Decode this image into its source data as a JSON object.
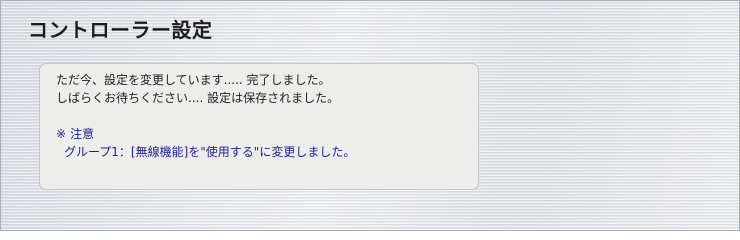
{
  "header": {
    "title": "コントローラー設定"
  },
  "message": {
    "line1": "ただ今、設定を変更しています..... 完了しました。",
    "line2": "しばらくお待ちください.... 設定は保存されました。"
  },
  "note": {
    "mark": "※",
    "heading": "注意",
    "body": "グループ1：[無線機能]を\"使用する\"に変更しました。"
  },
  "colors": {
    "note_text": "#1f1f8f",
    "box_background": "#ededeb",
    "box_border": "#c4c6c9"
  }
}
